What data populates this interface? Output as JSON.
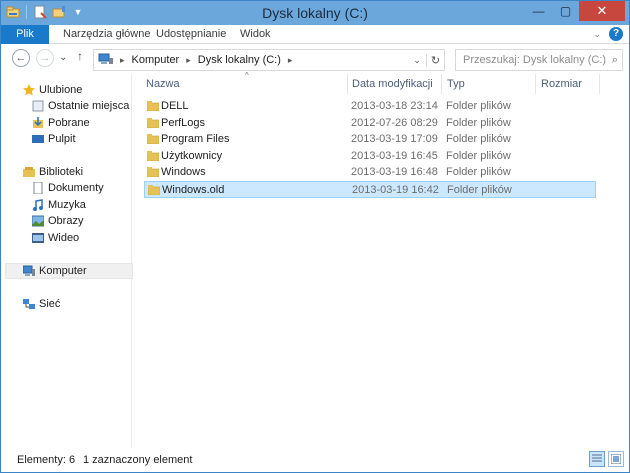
{
  "window": {
    "title": "Dysk lokalny (C:)"
  },
  "ribbon": {
    "tabs": [
      {
        "label": "Plik"
      },
      {
        "label": "Narzędzia główne"
      },
      {
        "label": "Udostępnianie"
      },
      {
        "label": "Widok"
      }
    ]
  },
  "address": {
    "crumbs": [
      "Komputer",
      "Dysk lokalny (C:)"
    ]
  },
  "search": {
    "placeholder": "Przeszukaj: Dysk lokalny (C:)"
  },
  "navpane": {
    "favorites": {
      "label": "Ulubione",
      "items": [
        "Ostatnie miejsca",
        "Pobrane",
        "Pulpit"
      ]
    },
    "libraries": {
      "label": "Biblioteki",
      "items": [
        "Dokumenty",
        "Muzyka",
        "Obrazy",
        "Wideo"
      ]
    },
    "computer": "Komputer",
    "network": "Sieć"
  },
  "columns": {
    "name": "Nazwa",
    "date": "Data modyfikacji",
    "type": "Typ",
    "size": "Rozmiar"
  },
  "files": [
    {
      "name": "DELL",
      "date": "2013-03-18 23:14",
      "type": "Folder plików",
      "selected": false
    },
    {
      "name": "PerfLogs",
      "date": "2012-07-26 08:29",
      "type": "Folder plików",
      "selected": false
    },
    {
      "name": "Program Files",
      "date": "2013-03-19 17:09",
      "type": "Folder plików",
      "selected": false
    },
    {
      "name": "Użytkownicy",
      "date": "2013-03-19 16:45",
      "type": "Folder plików",
      "selected": false
    },
    {
      "name": "Windows",
      "date": "2013-03-19 16:48",
      "type": "Folder plików",
      "selected": false
    },
    {
      "name": "Windows.old",
      "date": "2013-03-19 16:42",
      "type": "Folder plików",
      "selected": true
    }
  ],
  "status": {
    "count": "Elementy: 6",
    "selection": "1 zaznaczony element"
  },
  "colors": {
    "accent": "#1979ca",
    "titlebar": "#6ca7dc",
    "selection": "#cce8ff",
    "folder": "#e8c155"
  }
}
